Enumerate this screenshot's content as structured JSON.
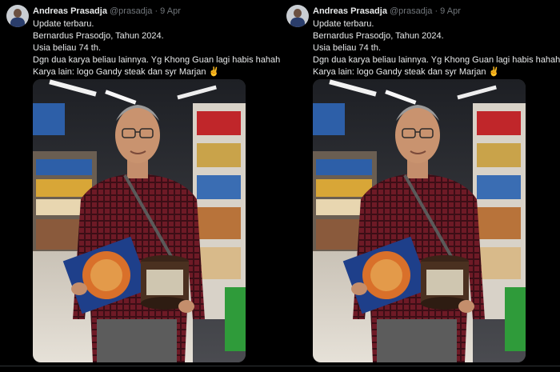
{
  "tweet": {
    "display_name": "Andreas Prasadja",
    "handle": "@prasadja",
    "separator": "·",
    "date": "9 Apr",
    "lines": [
      "Update terbaru.",
      "Bernardus Prasodjo, Tahun 2024.",
      "Usia beliau 74 th.",
      "Dgn dua karya beliau lainnya. Yg Khong Guan lagi habis hahahaha",
      "Karya lain: logo Gandy steak dan syr Marjan ✌"
    ]
  },
  "colors": {
    "background": "#000000",
    "text": "#e7e9ea",
    "muted": "#71767b",
    "shirt": "#7a1f2b"
  }
}
